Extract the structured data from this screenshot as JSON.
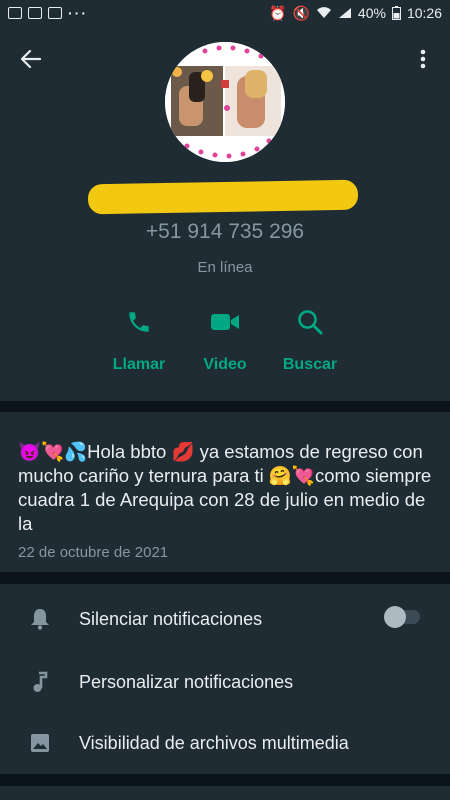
{
  "status_bar": {
    "battery": "40%",
    "time": "10:26",
    "more": "···"
  },
  "contact": {
    "phone": "+51 914 735 296",
    "presence": "En línea"
  },
  "actions": {
    "call": "Llamar",
    "video": "Video",
    "search": "Buscar"
  },
  "about": {
    "text": "😈💘💦Hola bbto 💋 ya estamos de regreso con mucho cariño y ternura para ti 🤗💘como siempre cuadra 1 de Arequipa con 28 de julio en medio de la",
    "date": "22 de octubre de 2021"
  },
  "settings": {
    "mute": "Silenciar notificaciones",
    "mute_on": false,
    "custom": "Personalizar notificaciones",
    "media": "Visibilidad de archivos multimedia"
  },
  "colors": {
    "accent": "#00a884",
    "background": "#0b141a",
    "panel": "#1f2c34",
    "secondary_text": "#8696a0"
  }
}
